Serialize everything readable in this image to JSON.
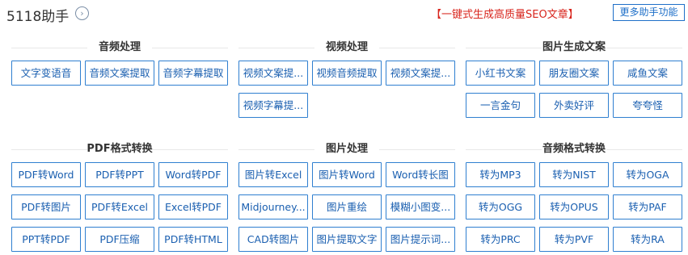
{
  "header": {
    "brand": "5118助手",
    "brand_icon": "chevron-right-circle-icon",
    "promo": "【一键式生成高质量SEO文章】",
    "more_label": "更多助手功能"
  },
  "sections": [
    {
      "title": "音频处理",
      "items": [
        "文字变语音",
        "音频文案提取",
        "音频字幕提取"
      ]
    },
    {
      "title": "视频处理",
      "items": [
        "视频文案提...",
        "视频音频提取",
        "视频文案提...",
        "视频字幕提..."
      ]
    },
    {
      "title": "图片生成文案",
      "items": [
        "小红书文案",
        "朋友圈文案",
        "咸鱼文案",
        "一言金句",
        "外卖好评",
        "夸夸怪"
      ]
    },
    {
      "title": "PDF格式转换",
      "items": [
        "PDF转Word",
        "PDF转PPT",
        "Word转PDF",
        "PDF转图片",
        "PDF转Excel",
        "Excel转PDF",
        "PPT转PDF",
        "PDF压缩",
        "PDF转HTML"
      ]
    },
    {
      "title": "图片处理",
      "items": [
        "图片转Excel",
        "图片转Word",
        "Word转长图",
        "Midjourney...",
        "图片重绘",
        "模糊小图变...",
        "CAD转图片",
        "图片提取文字",
        "图片提示词..."
      ]
    },
    {
      "title": "音频格式转换",
      "items": [
        "转为MP3",
        "转为NIST",
        "转为OGA",
        "转为OGG",
        "转为OPUS",
        "转为PAF",
        "转为PRC",
        "转为PVF",
        "转为RA"
      ]
    }
  ]
}
